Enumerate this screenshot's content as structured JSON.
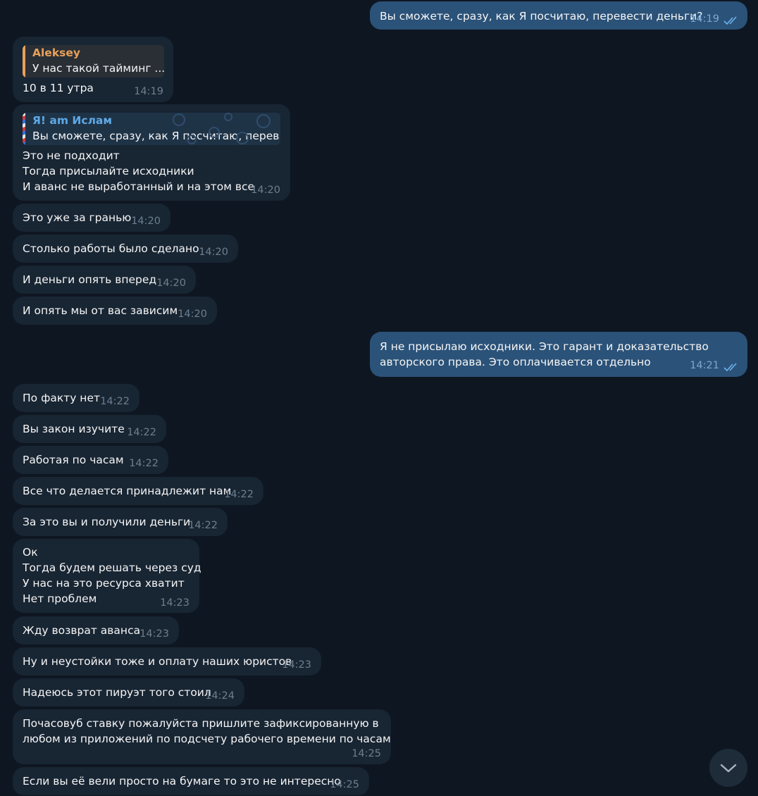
{
  "messages": [
    {
      "text": "Вы сможете, сразу, как Я посчитаю, перевести деньги?",
      "time": "14:19"
    },
    {
      "reply_name": "Aleksey",
      "reply_text": "У нас такой тайминг ...",
      "text": "10 в 11 утра",
      "time": "14:19"
    },
    {
      "reply_name": "Я! am Ислам",
      "reply_text": "Вы сможете, сразу, как Я посчитаю, перев...",
      "text": "Это не подходит\nТогда присылайте исходники\nИ аванс не выработанный и на этом все",
      "time": "14:20"
    },
    {
      "text": "Это уже за гранью",
      "time": "14:20"
    },
    {
      "text": "Столько работы было сделано",
      "time": "14:20"
    },
    {
      "text": "И деньги опять вперед",
      "time": "14:20"
    },
    {
      "text": "И опять мы от вас зависим",
      "time": "14:20"
    },
    {
      "text": "Я не присылаю исходники. Это гарант и доказательство\nавторского права. Это оплачивается отдельно",
      "time": "14:21"
    },
    {
      "text": "По факту нет",
      "time": "14:22"
    },
    {
      "text": "Вы закон изучите",
      "time": "14:22"
    },
    {
      "text": "Работая по часам",
      "time": "14:22"
    },
    {
      "text": "Все что делается принадлежит нам",
      "time": "14:22"
    },
    {
      "text": "За это вы и получили деньги",
      "time": "14:22"
    },
    {
      "text": "Ок\nТогда будем решать через суд\nУ нас на это ресурса хватит\nНет проблем",
      "time": "14:23"
    },
    {
      "text": "Жду возврат аванса",
      "time": "14:23"
    },
    {
      "text": "Ну и неустойки тоже и оплату наших юристов",
      "time": "14:23"
    },
    {
      "text": "Надеюсь этот пируэт того стоил",
      "time": "14:24"
    },
    {
      "text": "Почасовуб ставку пожалуйста пришлите зафиксированную в\nлюбом из приложений по подсчету рабочего времени по часам",
      "time": "14:25"
    },
    {
      "text": "Если вы её вели просто на бумаге то это не интересно",
      "time": "14:25"
    }
  ],
  "colors": {
    "background": "#0e1621",
    "incoming": "#182533",
    "outgoing": "#2b5278",
    "aleksey": "#e8a05a",
    "islam": "#5ea9e6",
    "ticks": "#6cb4f0"
  }
}
